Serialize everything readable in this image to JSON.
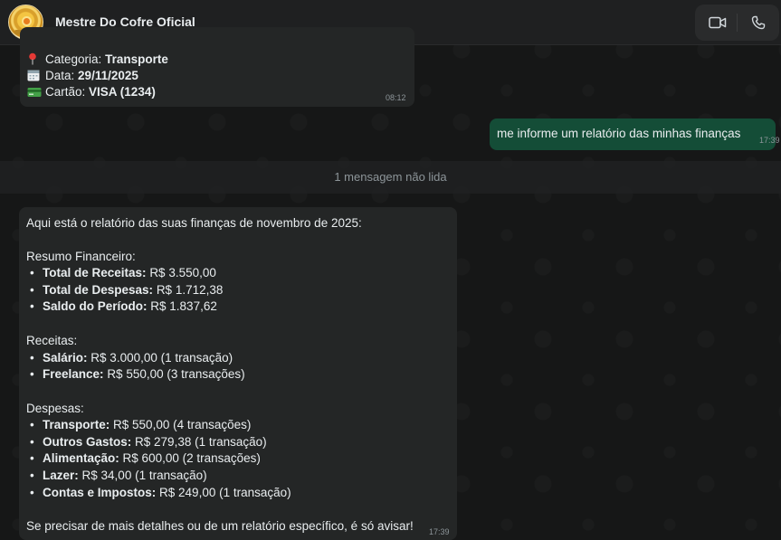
{
  "contact": {
    "name": "Mestre Do Cofre Oficial",
    "avatar_icon": "gold-coin-logo"
  },
  "header_actions": {
    "video_icon": "video-call-icon",
    "phone_icon": "voice-call-icon"
  },
  "message_partial": {
    "category_label": "Categoria:",
    "category_value": "Transporte",
    "date_label": "Data:",
    "date_value": "29/11/2025",
    "card_label": "Cartão:",
    "card_value": "VISA (1234)",
    "time": "08:12"
  },
  "message_out": {
    "text": "me informe um relatório das minhas finanças",
    "time": "17:39"
  },
  "unread_divider": "1 mensagem não lida",
  "report": {
    "intro": "Aqui está o relatório das suas finanças de novembro de 2025:",
    "summary_title": "Resumo Financeiro:",
    "summary": [
      {
        "label": "Total de Receitas:",
        "value": "R$ 3.550,00"
      },
      {
        "label": "Total de Despesas:",
        "value": "R$ 1.712,38"
      },
      {
        "label": "Saldo do Período:",
        "value": "R$ 1.837,62"
      }
    ],
    "income_title": "Receitas:",
    "income": [
      {
        "label": "Salário:",
        "value": "R$ 3.000,00 (1 transação)"
      },
      {
        "label": "Freelance:",
        "value": "R$ 550,00 (3 transações)"
      }
    ],
    "expenses_title": "Despesas:",
    "expenses": [
      {
        "label": "Transporte:",
        "value": "R$ 550,00 (4 transações)"
      },
      {
        "label": "Outros Gastos:",
        "value": "R$ 279,38 (1 transação)"
      },
      {
        "label": "Alimentação:",
        "value": "R$ 600,00 (2 transações)"
      },
      {
        "label": "Lazer:",
        "value": "R$ 34,00 (1 transação)"
      },
      {
        "label": "Contas e Impostos:",
        "value": "R$ 249,00 (1 transação)"
      }
    ],
    "bullet": "•",
    "closing": "Se precisar de mais detalhes ou de um relatório específico, é só avisar!",
    "time": "17:39"
  }
}
